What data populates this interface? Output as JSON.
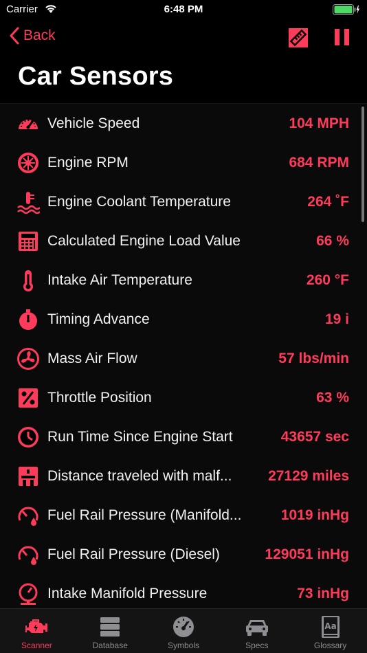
{
  "status": {
    "carrier": "Carrier",
    "time": "6:48 PM"
  },
  "nav": {
    "back_label": "Back"
  },
  "title": "Car Sensors",
  "sensors": [
    {
      "label": "Vehicle Speed",
      "value": "104 MPH",
      "icon": "speedometer-icon"
    },
    {
      "label": "Engine RPM",
      "value": "684 RPM",
      "icon": "turbine-icon"
    },
    {
      "label": "Engine Coolant Temperature",
      "value": "264 ˚F",
      "icon": "coolant-icon"
    },
    {
      "label": "Calculated Engine Load Value",
      "value": "66 %",
      "icon": "calculator-icon"
    },
    {
      "label": "Intake Air Temperature",
      "value": "260 °F",
      "icon": "thermometer-icon"
    },
    {
      "label": "Timing Advance",
      "value": "19 i",
      "icon": "stopwatch-icon"
    },
    {
      "label": "Mass Air Flow",
      "value": "57 lbs/min",
      "icon": "fan-icon"
    },
    {
      "label": "Throttle Position",
      "value": "63 %",
      "icon": "percent-icon"
    },
    {
      "label": "Run Time Since Engine Start",
      "value": "43657 sec",
      "icon": "clock-icon"
    },
    {
      "label": "Distance traveled with malf...",
      "value": "27129 miles",
      "icon": "road-icon"
    },
    {
      "label": "Fuel Rail Pressure (Manifold...",
      "value": "1019 inHg",
      "icon": "fuel-gauge-icon"
    },
    {
      "label": "Fuel Rail Pressure (Diesel)",
      "value": "129051 inHg",
      "icon": "fuel-gauge-icon"
    },
    {
      "label": "Intake Manifold Pressure",
      "value": "73 inHg",
      "icon": "pressure-gauge-icon"
    }
  ],
  "tabs": [
    {
      "label": "Scanner",
      "icon": "engine-icon",
      "active": true
    },
    {
      "label": "Database",
      "icon": "database-icon",
      "active": false
    },
    {
      "label": "Symbols",
      "icon": "gauge-icon",
      "active": false
    },
    {
      "label": "Specs",
      "icon": "car-icon",
      "active": false
    },
    {
      "label": "Glossary",
      "icon": "dictionary-icon",
      "active": false
    }
  ],
  "colors": {
    "accent": "#ff3b5c",
    "background": "#000000",
    "inactive": "#8e8e93"
  }
}
